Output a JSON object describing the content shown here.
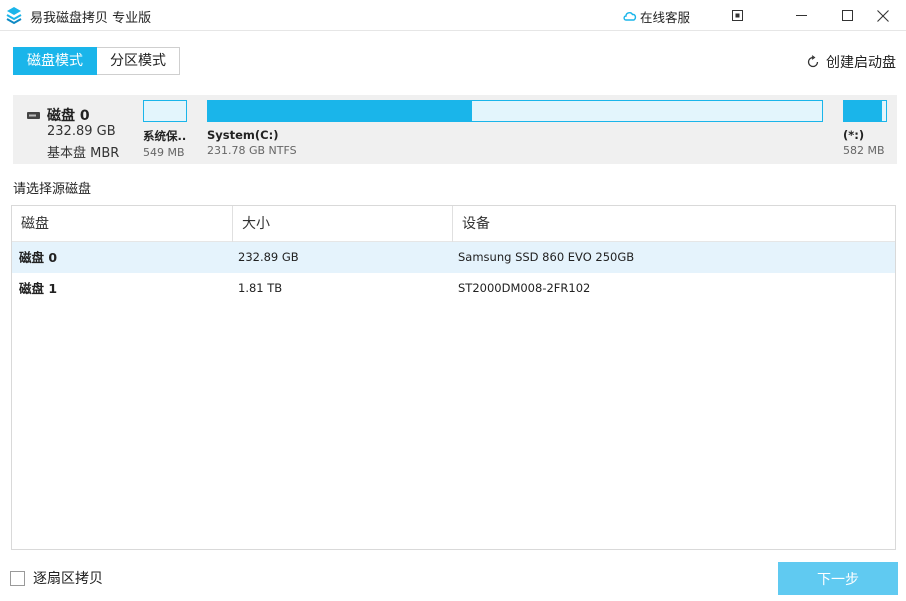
{
  "window": {
    "title": "易我磁盘拷贝 专业版",
    "support_label": "在线客服"
  },
  "modes": {
    "tabs": [
      {
        "label": "磁盘模式",
        "active": true
      },
      {
        "label": "分区模式",
        "active": false
      }
    ],
    "boot_disk_label": "创建启动盘"
  },
  "disk_map": {
    "name": "磁盘 0",
    "size": "232.89 GB",
    "type": "基本盘 MBR",
    "partitions": [
      {
        "name": "系统保...",
        "info": "549 MB ...",
        "used_fraction": 0.0
      },
      {
        "name": "System(C:)",
        "info": "231.78 GB NTFS",
        "used_fraction": 0.43
      },
      {
        "name": "(*:)",
        "info": "582 MB ...",
        "used_fraction": 0.9
      }
    ]
  },
  "source_prompt": "请选择源磁盘",
  "table": {
    "headers": [
      "磁盘",
      "大小",
      "设备"
    ],
    "rows": [
      {
        "disk": "磁盘 0",
        "size": "232.89 GB",
        "device": "Samsung SSD 860 EVO 250GB",
        "selected": true
      },
      {
        "disk": "磁盘 1",
        "size": "1.81 TB",
        "device": "ST2000DM008-2FR102",
        "selected": false
      }
    ]
  },
  "footer": {
    "sector_copy_label": "逐扇区拷贝",
    "next_label": "下一步"
  },
  "colors": {
    "accent": "#1ab5ea",
    "next_button": "#60caf1",
    "selected_row": "#e5f3fc"
  },
  "icons": [
    "app-logo-icon",
    "cloud-chat-icon",
    "pin-window-icon",
    "minimize-icon",
    "maximize-icon",
    "close-icon",
    "refresh-disc-icon",
    "hard-disk-icon"
  ]
}
